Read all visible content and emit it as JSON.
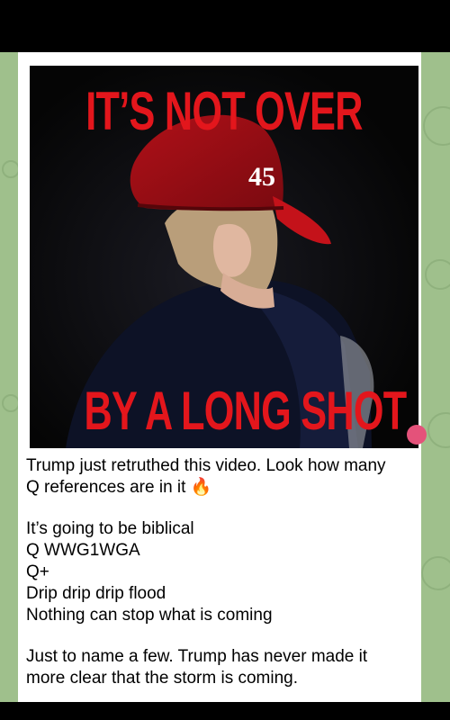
{
  "message": {
    "image": {
      "headline_top": "IT’S NOT OVER",
      "headline_bottom": "BY A LONG SHOT",
      "cap_number": "45"
    },
    "caption": {
      "line1": "Trump just retruthed this video. Look how many",
      "line2": "Q references are in it",
      "line2_icon": "fire-emoji-icon",
      "line3": "It’s going to be biblical",
      "line4": "Q WWG1WGA",
      "line5": "Q+",
      "line6": "Drip drip drip flood",
      "line7": "Nothing can stop what is coming",
      "line8": "Just to name a few. Trump has never made it",
      "line9": "more clear that the storm is coming."
    }
  },
  "colors": {
    "headline": "#e3161c",
    "chat_background": "#9fc08c",
    "bubble": "#ffffff",
    "accent_dot": "#e4527a"
  }
}
